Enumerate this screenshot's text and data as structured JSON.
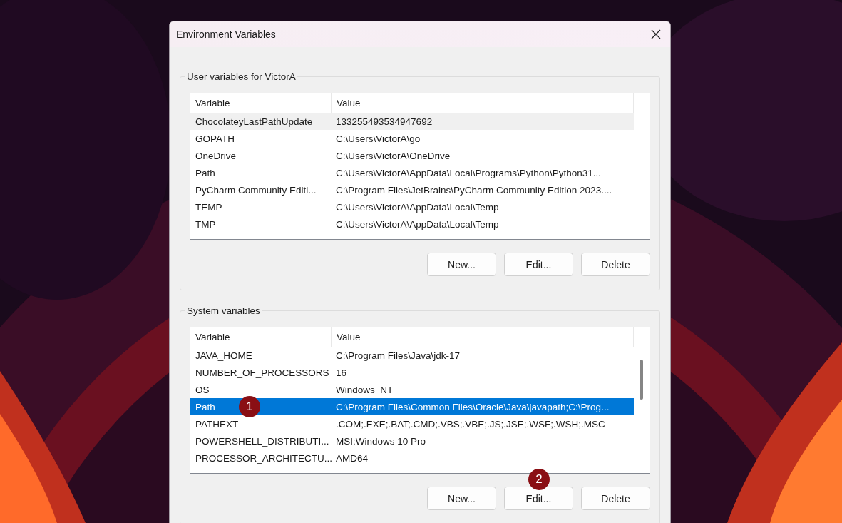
{
  "window": {
    "title": "Environment Variables"
  },
  "groups": [
    {
      "title": "User variables for VictorA",
      "focused": false,
      "columns": [
        "Variable",
        "Value"
      ],
      "rows": [
        {
          "variable": "ChocolateyLastPathUpdate",
          "value": "133255493534947692",
          "selected": true
        },
        {
          "variable": "GOPATH",
          "value": "C:\\Users\\VictorA\\go",
          "selected": false
        },
        {
          "variable": "OneDrive",
          "value": "C:\\Users\\VictorA\\OneDrive",
          "selected": false
        },
        {
          "variable": "Path",
          "value": "C:\\Users\\VictorA\\AppData\\Local\\Programs\\Python\\Python31...",
          "selected": false
        },
        {
          "variable": "PyCharm Community Editi...",
          "value": "C:\\Program Files\\JetBrains\\PyCharm Community Edition 2023....",
          "selected": false
        },
        {
          "variable": "TEMP",
          "value": "C:\\Users\\VictorA\\AppData\\Local\\Temp",
          "selected": false
        },
        {
          "variable": "TMP",
          "value": "C:\\Users\\VictorA\\AppData\\Local\\Temp",
          "selected": false
        }
      ],
      "buttons": [
        {
          "label": "New..."
        },
        {
          "label": "Edit..."
        },
        {
          "label": "Delete"
        }
      ]
    },
    {
      "title": "System variables",
      "focused": true,
      "columns": [
        "Variable",
        "Value"
      ],
      "rows": [
        {
          "variable": "JAVA_HOME",
          "value": "C:\\Program Files\\Java\\jdk-17",
          "selected": false
        },
        {
          "variable": "NUMBER_OF_PROCESSORS",
          "value": "16",
          "selected": false
        },
        {
          "variable": "OS",
          "value": "Windows_NT",
          "selected": false
        },
        {
          "variable": "Path",
          "value": "C:\\Program Files\\Common Files\\Oracle\\Java\\javapath;C:\\Prog...",
          "selected": true,
          "badge": "1"
        },
        {
          "variable": "PATHEXT",
          "value": ".COM;.EXE;.BAT;.CMD;.VBS;.VBE;.JS;.JSE;.WSF;.WSH;.MSC",
          "selected": false
        },
        {
          "variable": "POWERSHELL_DISTRIBUTI...",
          "value": "MSI:Windows 10 Pro",
          "selected": false
        },
        {
          "variable": "PROCESSOR_ARCHITECTU...",
          "value": "AMD64",
          "selected": false
        }
      ],
      "buttons": [
        {
          "label": "New..."
        },
        {
          "label": "Edit...",
          "badge": "2"
        },
        {
          "label": "Delete"
        }
      ]
    }
  ]
}
